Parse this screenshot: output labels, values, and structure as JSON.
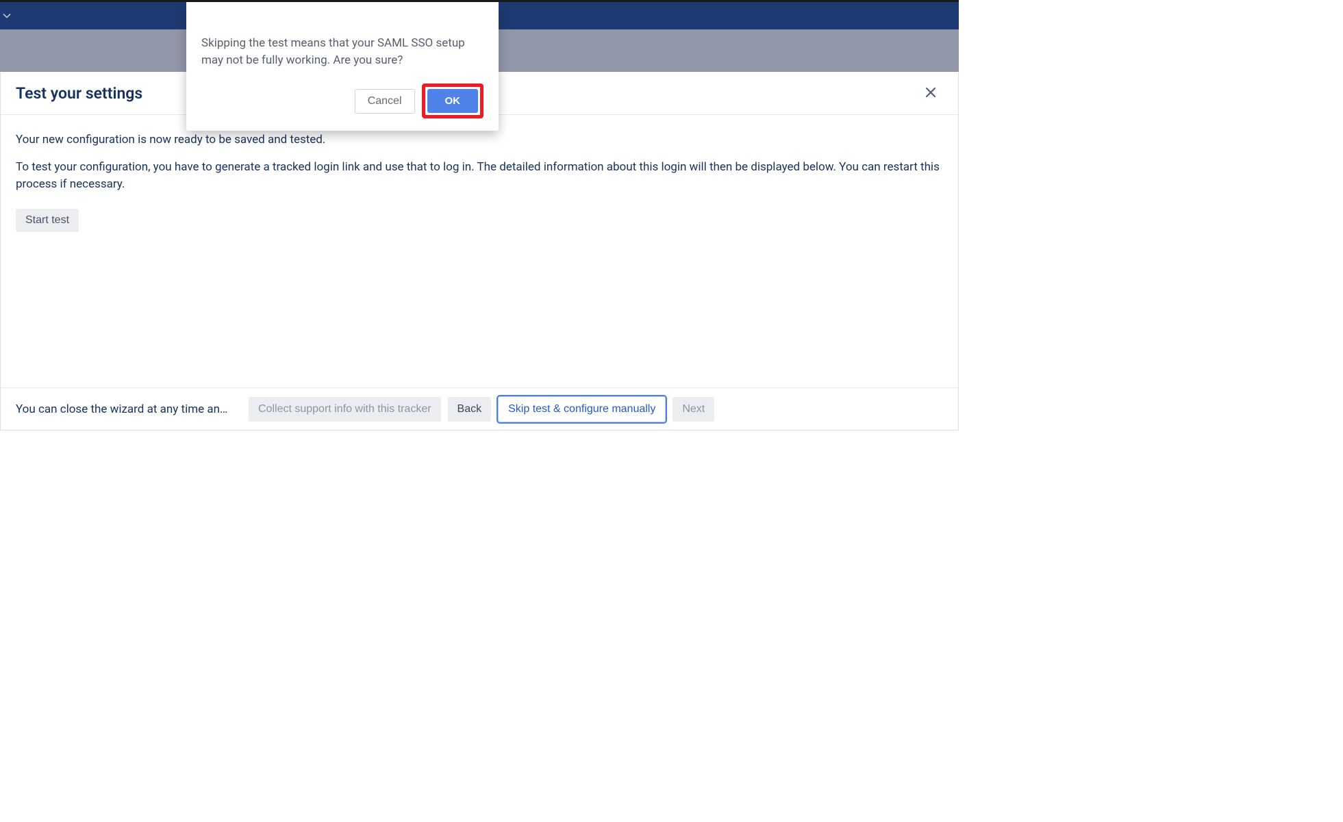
{
  "header": {
    "page_title": "Test your settings"
  },
  "body": {
    "intro_text": "Your new configuration is now ready to be saved and tested.",
    "instructions": "To test your configuration, you have to generate a tracked login link and use that to log in. The detailed information about this login will then be displayed below. You can restart this process if necessary.",
    "start_test_label": "Start test"
  },
  "footer": {
    "info_text": "You can close the wizard at any time and con...",
    "collect_label": "Collect support info with this tracker",
    "back_label": "Back",
    "skip_label": "Skip test & configure manually",
    "next_label": "Next"
  },
  "modal": {
    "message": "Skipping the test means that your SAML SSO setup may not be fully working. Are you sure?",
    "cancel_label": "Cancel",
    "ok_label": "OK"
  }
}
